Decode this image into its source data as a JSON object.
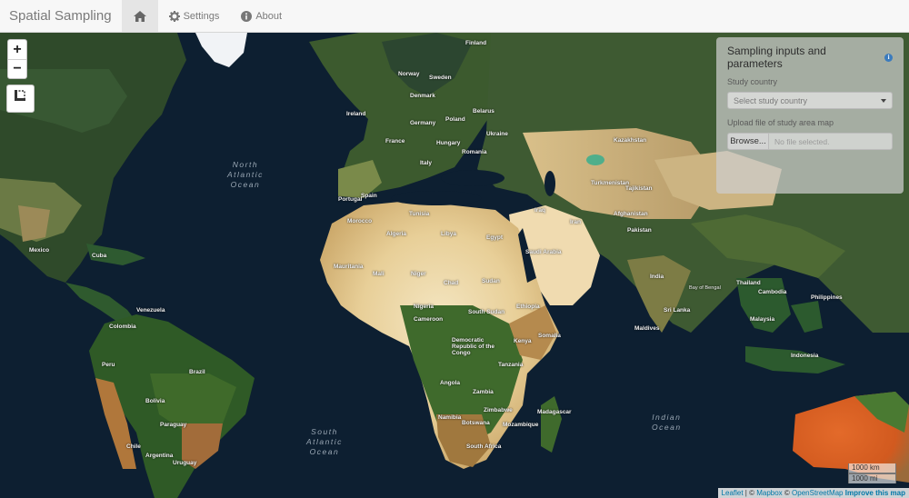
{
  "navbar": {
    "brand": "Spatial Sampling",
    "items": [
      {
        "label": "",
        "icon": "home-icon",
        "active": true
      },
      {
        "label": "Settings",
        "icon": "gear-icon"
      },
      {
        "label": "About",
        "icon": "info-icon"
      }
    ]
  },
  "map": {
    "zoom_in": "+",
    "zoom_out": "−",
    "ocean_labels": {
      "north_atlantic": [
        "North",
        "Atlantic",
        "Ocean"
      ],
      "south_atlantic": [
        "South",
        "Atlantic",
        "Ocean"
      ],
      "indian": [
        "Indian",
        "Ocean"
      ]
    },
    "place_labels": [
      "Finland",
      "Sweden",
      "Norway",
      "Denmark",
      "Ireland",
      "Belarus",
      "Germany",
      "Poland",
      "Ukraine",
      "France",
      "Hungary",
      "Romania",
      "Italy",
      "Kazakhstan",
      "Turkmenistan",
      "Tajikistan",
      "Afghanistan",
      "Pakistan",
      "Algeria",
      "Libya",
      "Egypt",
      "Mali",
      "Niger",
      "Chad",
      "Sudan",
      "Mauritania",
      "Nigeria",
      "Cameroon",
      "South Sudan",
      "Ethiopia",
      "Saudi Arabia",
      "Iraq",
      "Iran",
      "India",
      "Kenya",
      "Somalia",
      "Democratic Republic of the Congo",
      "Tanzania",
      "Angola",
      "Zambia",
      "Zimbabwe",
      "Namibia",
      "Botswana",
      "South Africa",
      "Madagascar",
      "Mozambique",
      "Maldives",
      "Sri Lanka",
      "Bay of Bengal",
      "Thailand",
      "Cambodia",
      "Philippines",
      "Malaysia",
      "Indonesia",
      "Cuba",
      "Mexico",
      "Colombia",
      "Venezuela",
      "Peru",
      "Brazil",
      "Bolivia",
      "Paraguay",
      "Chile",
      "Argentina",
      "Uruguay",
      "Morocco",
      "Tunisia",
      "Spain",
      "Portugal"
    ]
  },
  "panel": {
    "title": "Sampling inputs and parameters",
    "info_icon": "i",
    "study_country_label": "Study country",
    "study_country_placeholder": "Select study country",
    "upload_label": "Upload file of study area map",
    "browse_label": "Browse...",
    "file_placeholder": "No file selected."
  },
  "scale": {
    "km": "1000 km",
    "mi": "1000 mi"
  },
  "attribution": {
    "leaflet": "Leaflet",
    "sep1": " | © ",
    "mapbox": "Mapbox",
    "sep2": " © ",
    "osm": "OpenStreetMap",
    "improve": "Improve this map"
  }
}
